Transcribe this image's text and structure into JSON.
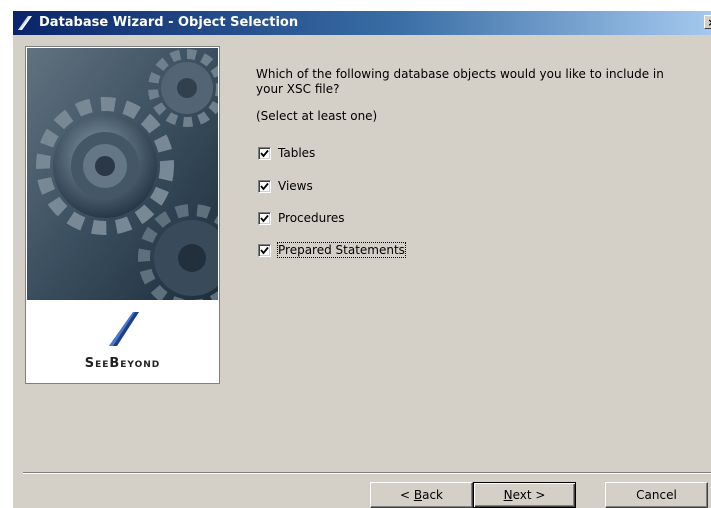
{
  "window": {
    "title": "Database Wizard - Object Selection",
    "close_glyph": "×"
  },
  "side": {
    "logo_text": "SeeBeyond"
  },
  "prompt": {
    "question": "Which of the following database objects would you like to include in your XSC file?",
    "hint": "(Select at least one)"
  },
  "options": [
    {
      "label": "Tables",
      "checked": true
    },
    {
      "label": "Views",
      "checked": true
    },
    {
      "label": "Procedures",
      "checked": true
    },
    {
      "label": "Prepared Statements",
      "checked": true,
      "focused": true
    }
  ],
  "buttons": {
    "back": {
      "prefix": "< ",
      "mnemonic": "B",
      "rest": "ack"
    },
    "next": {
      "mnemonic": "N",
      "rest": "ext >"
    },
    "cancel": "Cancel"
  },
  "colors": {
    "titlebar_start": "#0a246a",
    "titlebar_end": "#a6caf0",
    "dialog_bg": "#d4d0c8",
    "logo_blue": "#1b3f8f"
  },
  "icons": {
    "app": "wizard-slash-icon",
    "close": "close-icon",
    "check": "checkmark-icon",
    "logo": "seebeyond-logo-icon"
  }
}
